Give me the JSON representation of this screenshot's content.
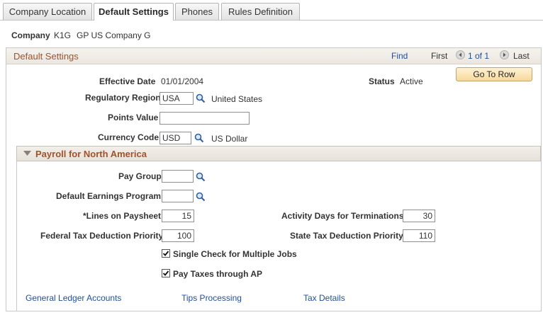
{
  "tabs": [
    {
      "label": "Company Location",
      "active": false
    },
    {
      "label": "Default Settings",
      "active": true
    },
    {
      "label": "Phones",
      "active": false
    },
    {
      "label": "Rules Definition",
      "active": false
    }
  ],
  "company": {
    "label": "Company",
    "code": "K1G",
    "name": "GP US Company G"
  },
  "panel": {
    "title": "Default Settings",
    "find": "Find",
    "first": "First",
    "pager": "1 of 1",
    "last": "Last",
    "go_to_row": "Go To Row"
  },
  "fields": {
    "effective_date": {
      "label": "Effective Date",
      "value": "01/01/2004"
    },
    "status": {
      "label": "Status",
      "value": "Active"
    },
    "regulatory_region": {
      "label": "Regulatory Region",
      "value": "USA",
      "desc": "United States"
    },
    "points_value": {
      "label": "Points Value",
      "value": ""
    },
    "currency_code": {
      "label": "Currency Code",
      "value": "USD",
      "desc": "US Dollar"
    }
  },
  "payroll": {
    "title": "Payroll for North America",
    "pay_group": {
      "label": "Pay Group",
      "value": ""
    },
    "default_earnings_program": {
      "label": "Default Earnings Program",
      "value": ""
    },
    "lines_on_paysheet": {
      "label": "*Lines on Paysheet",
      "value": "15"
    },
    "activity_days": {
      "label": "Activity Days for Terminations",
      "value": "30"
    },
    "federal_tax_priority": {
      "label": "Federal Tax Deduction Priority",
      "value": "100"
    },
    "state_tax_priority": {
      "label": "State Tax Deduction Priority",
      "value": "110"
    },
    "single_check": {
      "label": "Single Check for Multiple Jobs",
      "checked": true
    },
    "pay_taxes_ap": {
      "label": "Pay Taxes through AP",
      "checked": true
    }
  },
  "links": {
    "gl_accounts": "General Ledger Accounts",
    "tips_processing": "Tips Processing",
    "tax_details": "Tax Details"
  },
  "colors": {
    "section_title": "#a0522d",
    "link": "#1f4f9c",
    "button_bg": "#f6d99a"
  }
}
